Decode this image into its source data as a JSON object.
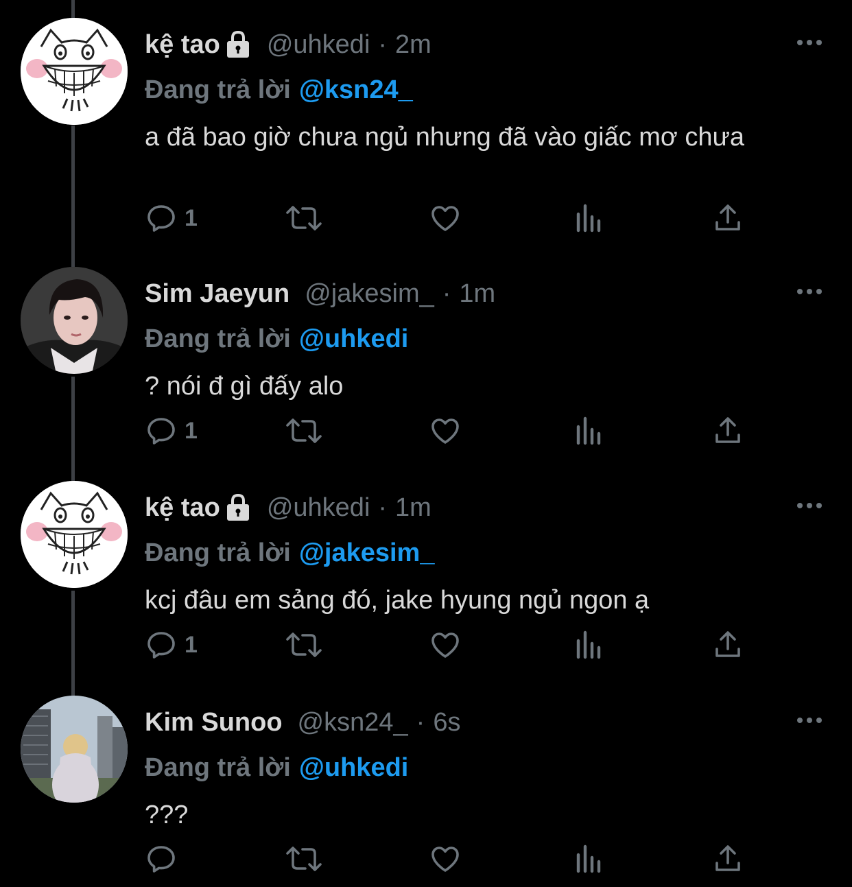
{
  "colors": {
    "background": "#000000",
    "text_primary": "#d9d9d9",
    "text_secondary": "#6e767d",
    "accent": "#1d9bf0",
    "thread_line": "#3d4045"
  },
  "tweets": [
    {
      "display_name": "kệ tao",
      "protected_icon": "lock-icon",
      "handle": "@uhkedi",
      "separator": "·",
      "time": "2m",
      "replying_label": "Đang trả lời",
      "replying_to": "@ksn24_",
      "text": "a đã bao giờ chưa ngủ nhưng đã vào giấc mơ chưa",
      "reply_count": "1",
      "avatar": "cat-drawing-avatar"
    },
    {
      "display_name": "Sim Jaeyun",
      "handle": "@jakesim_",
      "separator": "·",
      "time": "1m",
      "replying_label": "Đang trả lời",
      "replying_to": "@uhkedi",
      "text": "? nói đ gì đấy alo",
      "reply_count": "1",
      "avatar": "portrait-photo-avatar"
    },
    {
      "display_name": "kệ tao",
      "protected_icon": "lock-icon",
      "handle": "@uhkedi",
      "separator": "·",
      "time": "1m",
      "replying_label": "Đang trả lời",
      "replying_to": "@jakesim_",
      "text": "kcj đâu em sảng đó, jake hyung ngủ ngon ạ",
      "reply_count": "1",
      "avatar": "cat-drawing-avatar"
    },
    {
      "display_name": "Kim Sunoo",
      "handle": "@ksn24_",
      "separator": "·",
      "time": "6s",
      "replying_label": "Đang trả lời",
      "replying_to": "@uhkedi",
      "text": "???",
      "reply_count": "",
      "avatar": "city-photo-avatar"
    }
  ],
  "action_icons": [
    "reply-icon",
    "retweet-icon",
    "like-icon",
    "analytics-icon",
    "share-icon"
  ],
  "more_icon": "more-options-icon"
}
